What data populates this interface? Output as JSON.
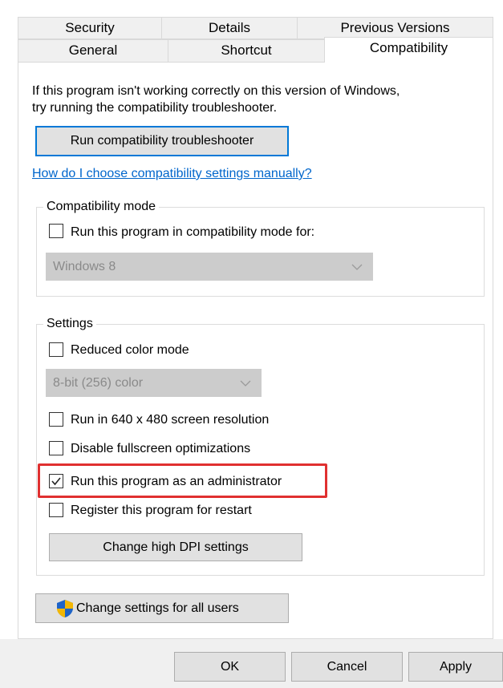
{
  "tabs": {
    "row1": [
      {
        "label": "Security"
      },
      {
        "label": "Details"
      },
      {
        "label": "Previous Versions"
      }
    ],
    "row2": [
      {
        "label": "General"
      },
      {
        "label": "Shortcut"
      },
      {
        "label": "Compatibility",
        "active": true
      }
    ]
  },
  "intro": {
    "line1": "If this program isn't working correctly on this version of Windows,",
    "line2": "try running the compatibility troubleshooter."
  },
  "troubleshooter_button": "Run compatibility troubleshooter",
  "manual_link": "How do I choose compatibility settings manually?",
  "compat_mode": {
    "legend": "Compatibility mode",
    "checkbox_label": "Run this program in compatibility mode for:",
    "checked": false,
    "select_value": "Windows 8"
  },
  "settings": {
    "legend": "Settings",
    "reduced_color": {
      "label": "Reduced color mode",
      "checked": false
    },
    "color_select_value": "8-bit (256) color",
    "res_640": {
      "label": "Run in 640 x 480 screen resolution",
      "checked": false
    },
    "disable_fullscreen": {
      "label": "Disable fullscreen optimizations",
      "checked": false
    },
    "run_as_admin": {
      "label": "Run this program as an administrator",
      "checked": true
    },
    "register_restart": {
      "label": "Register this program for restart",
      "checked": false
    },
    "dpi_button": "Change high DPI settings"
  },
  "all_users_button": {
    "label": "Change settings for all users",
    "icon": "uac-shield-icon"
  },
  "footer": {
    "ok": "OK",
    "cancel": "Cancel",
    "apply": "Apply"
  },
  "colors": {
    "accent": "#0078d7",
    "link": "#0066cc",
    "highlight": "#e03030"
  }
}
